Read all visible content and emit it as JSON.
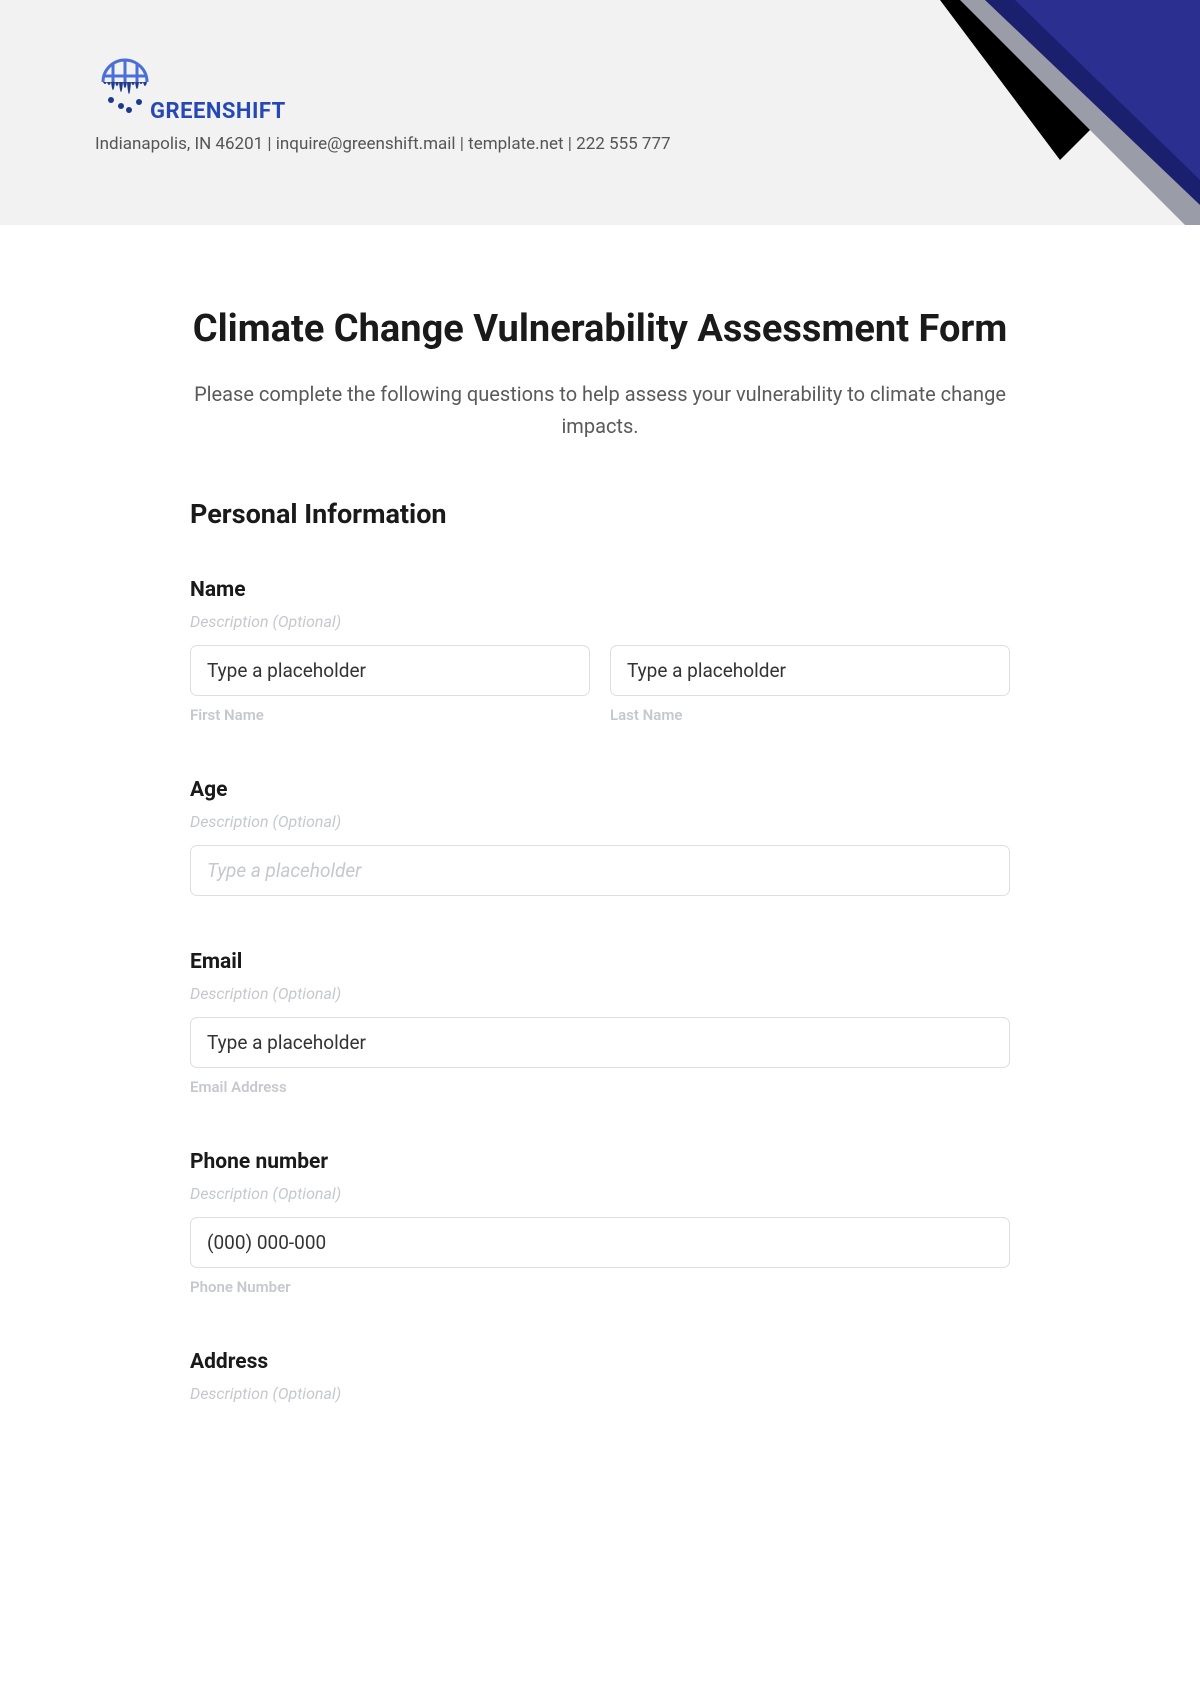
{
  "header": {
    "org_name": "GREENSHIFT",
    "org_info": "Indianapolis, IN 46201 | inquire@greenshift.mail | template.net | 222 555 777"
  },
  "form": {
    "title": "Climate Change Vulnerability Assessment Form",
    "subtitle": "Please complete the following questions to help assess your vulnerability to climate change impacts.",
    "section_label": "Personal Information",
    "desc_optional": "Description (Optional)",
    "name": {
      "label": "Name",
      "first_placeholder": "Type a placeholder",
      "last_placeholder": "Type a placeholder",
      "first_sublabel": "First Name",
      "last_sublabel": "Last Name"
    },
    "age": {
      "label": "Age",
      "placeholder": "Type a placeholder"
    },
    "email": {
      "label": "Email",
      "placeholder": "Type a placeholder",
      "sublabel": "Email Address"
    },
    "phone": {
      "label": "Phone number",
      "placeholder": "(000) 000-000",
      "sublabel": "Phone Number"
    },
    "address": {
      "label": "Address"
    }
  }
}
